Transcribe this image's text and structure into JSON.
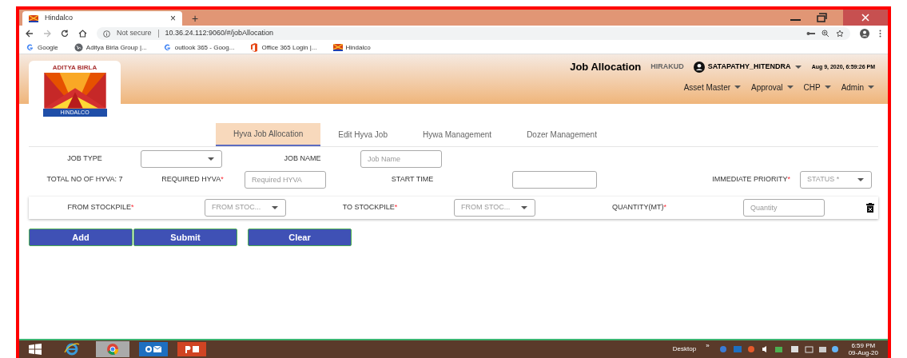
{
  "browser": {
    "tab_title": "Hindalco",
    "tab_close": "×",
    "new_tab": "+",
    "security": "Not secure",
    "url": "10.36.24.112:9060/#/jobAllocation",
    "bookmarks": [
      {
        "label": "Aditya Birla Group |...",
        "kind": "globe"
      },
      {
        "label": "outlook 365 - Goog...",
        "kind": "google"
      },
      {
        "label": "Office 365 Login |...",
        "kind": "office"
      },
      {
        "label": "Hindalco",
        "kind": "hindalco"
      }
    ],
    "first_bookmark": "Google"
  },
  "header": {
    "logo_top": "ADITYA BIRLA",
    "logo_bottom": "HINDALCO",
    "title": "Job Allocation",
    "plant": "HIRAKUD",
    "user": "SATAPATHY_HITENDRA",
    "datetime": "Aug 9, 2020, 6:59:26 PM",
    "menus": [
      "Asset Master",
      "Approval",
      "CHP",
      "Admin"
    ]
  },
  "tabs": [
    {
      "label": "Hyva Job Allocation",
      "selected": true
    },
    {
      "label": "Edit Hyva Job",
      "selected": false
    },
    {
      "label": "Hywa Management",
      "selected": false
    },
    {
      "label": "Dozer Management",
      "selected": false
    }
  ],
  "required_mark": "*",
  "form": {
    "job_type_label": "JOB TYPE",
    "job_name_label": "JOB NAME",
    "job_name_placeholder": "Job Name",
    "total_hyva": "TOTAL NO OF HYVA: 7",
    "required_hyva_label": "REQUIRED HYVA",
    "required_hyva_placeholder": "Required HYVA",
    "start_time_label": "START TIME",
    "priority_label": "IMMEDIATE PRIORITY",
    "status_placeholder": "STATUS *"
  },
  "stockpile": {
    "from_label": "FROM STOCKPILE",
    "from_placeholder": "FROM STOC...",
    "to_label": "TO STOCKPILE",
    "to_placeholder": "FROM STOC...",
    "quantity_label": "QUANTITY(MT)",
    "quantity_placeholder": "Quantity"
  },
  "buttons": [
    "Add",
    "Submit",
    "Clear"
  ],
  "taskbar": {
    "desktop": "Desktop",
    "chevron": "»",
    "time": "6:59 PM",
    "date": "09-Aug-20"
  }
}
